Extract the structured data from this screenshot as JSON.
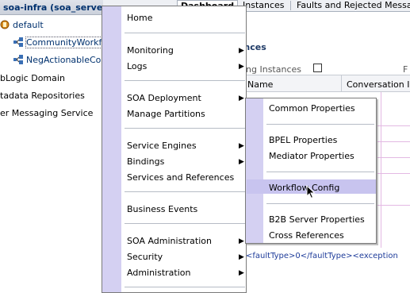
{
  "navigator": {
    "header": "soa-infra (soa_server1)",
    "items": [
      {
        "label": "default"
      },
      {
        "label": "CommunityWorkflo"
      },
      {
        "label": "NegActionableCon"
      },
      {
        "label": "bLogic Domain"
      },
      {
        "label": "tadata Repositories"
      },
      {
        "label": "er Messaging Service"
      }
    ]
  },
  "tabs": [
    "Dashboard",
    "Instances",
    "Faults and Rejected Message"
  ],
  "content": {
    "section_title": "ances",
    "running_label": "ning Instances",
    "trailing_f": "F",
    "columns": [
      "Name",
      "Conversation ID"
    ],
    "fault_text": "<faultType>0</faultType><exception"
  },
  "menu": {
    "items": [
      {
        "label": "Home"
      },
      {
        "label": "Monitoring"
      },
      {
        "label": "Logs"
      },
      {
        "label": "SOA Deployment"
      },
      {
        "label": "Manage Partitions"
      },
      {
        "label": "Service Engines"
      },
      {
        "label": "Bindings"
      },
      {
        "label": "Services and References"
      },
      {
        "label": "Business Events"
      },
      {
        "label": "SOA Administration"
      },
      {
        "label": "Security"
      },
      {
        "label": "Administration"
      }
    ],
    "submenu": [
      {
        "label": "Common Properties"
      },
      {
        "label": "BPEL Properties"
      },
      {
        "label": "Mediator Properties"
      },
      {
        "label": "Workflow Config"
      },
      {
        "label": "B2B Server Properties"
      },
      {
        "label": "Cross References"
      }
    ]
  },
  "colors": {
    "menu_gutter": "#d4d0f2",
    "highlight": "#c8c4ef",
    "link": "#00316e"
  }
}
